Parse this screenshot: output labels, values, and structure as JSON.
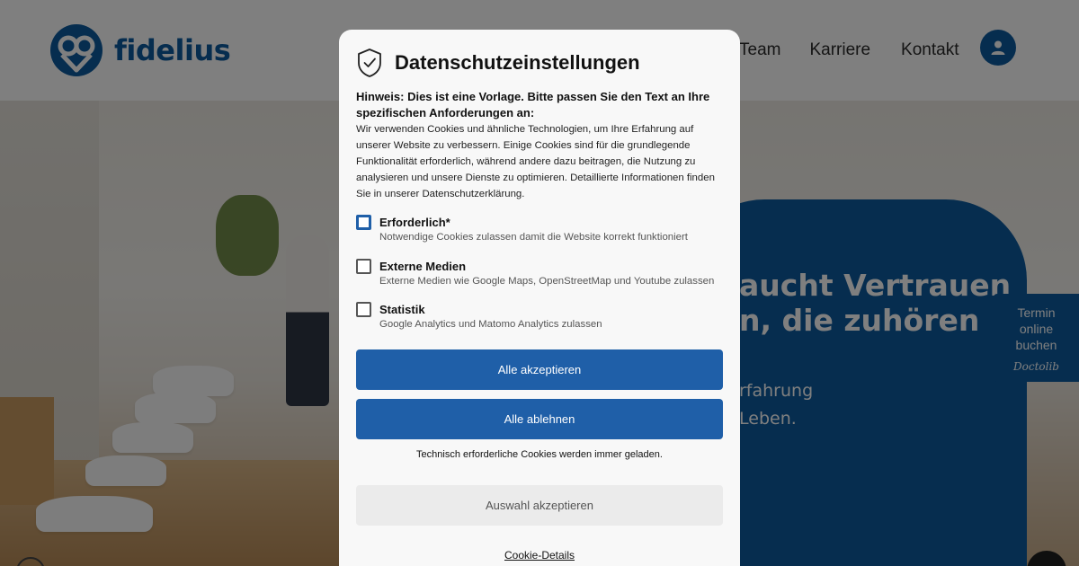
{
  "site": {
    "logo_text": "fidelius",
    "nav": [
      "Team",
      "Karriere",
      "Kontakt"
    ],
    "hero_title_lines": [
      "aucht Vertrauen",
      "n, die zuhören"
    ],
    "hero_sub_lines": [
      "rfahrung",
      "Leben."
    ],
    "doctolib": {
      "lines": [
        "Termin",
        "online",
        "buchen"
      ],
      "brand": "Doctolib"
    },
    "brand_color": "#0c5a9e"
  },
  "dialog": {
    "title": "Datenschutzeinstellungen",
    "notice": "Hinweis: Dies ist eine Vorlage. Bitte passen Sie den Text an Ihre spezifischen Anforderungen an:",
    "body": "Wir verwenden Cookies und ähnliche Technologien, um Ihre Erfahrung auf unserer Website zu verbessern. Einige Cookies sind für die grundlegende Funktionalität erforderlich, während andere dazu beitragen, die Nutzung zu analysieren und unsere Dienste zu optimieren. Detaillierte Informationen finden Sie in unserer Datenschutzerklärung.",
    "options": [
      {
        "title": "Erforderlich*",
        "desc": "Notwendige Cookies zulassen damit die Website korrekt funktioniert",
        "checked": false
      },
      {
        "title": "Externe Medien",
        "desc": "Externe Medien wie Google Maps, OpenStreetMap und Youtube zulassen",
        "checked": false
      },
      {
        "title": "Statistik",
        "desc": "Google Analytics und Matomo Analytics zulassen",
        "checked": false
      }
    ],
    "accept_all": "Alle akzeptieren",
    "reject_all": "Alle ablehnen",
    "info": "Technisch erforderliche Cookies werden immer geladen.",
    "accept_selection": "Auswahl akzeptieren",
    "details": "Cookie-Details",
    "accent_color": "#1f5fa8"
  }
}
